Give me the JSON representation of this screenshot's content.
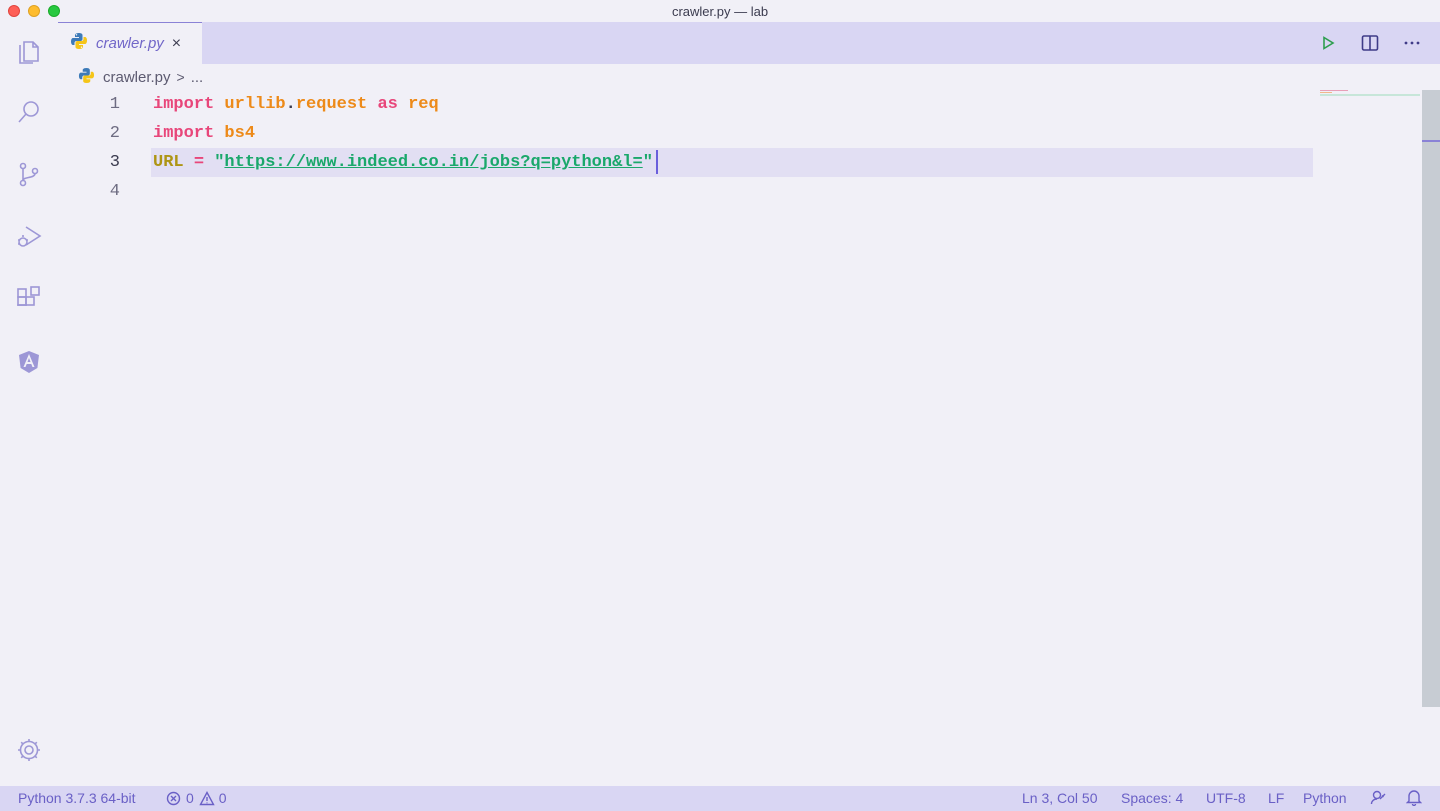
{
  "window": {
    "title": "crawler.py — lab"
  },
  "activity_bar": {
    "items": [
      "explorer-icon",
      "search-icon",
      "source-control-icon",
      "run-debug-icon",
      "extensions-icon",
      "angular-icon"
    ],
    "settings": "gear-icon"
  },
  "tabs": [
    {
      "label": "crawler.py",
      "icon": "python-icon",
      "close": "×"
    }
  ],
  "editor_actions": [
    "run-icon",
    "split-editor-icon",
    "more-actions-icon"
  ],
  "breadcrumb": {
    "file": "crawler.py",
    "separator": ">",
    "more": "..."
  },
  "editor": {
    "lines": [
      {
        "number": "1",
        "tokens": {
          "kw": "import",
          "mod1": "urllib",
          "dot": ".",
          "mod2": "request",
          "kw2": "as",
          "alias": "req"
        }
      },
      {
        "number": "2",
        "tokens": {
          "kw": "import",
          "mod": "bs4"
        }
      },
      {
        "number": "3",
        "tokens": {
          "var": "URL",
          "op": "=",
          "q1": "\"",
          "url": "https://www.indeed.co.in/jobs?q=python&l=",
          "q2": "\""
        }
      },
      {
        "number": "4"
      }
    ],
    "current_line": 3
  },
  "status_bar": {
    "interpreter": "Python 3.7.3 64-bit",
    "errors": "0",
    "warnings": "0",
    "cursor_position": "Ln 3, Col 50",
    "indentation": "Spaces: 4",
    "encoding": "UTF-8",
    "eol": "LF",
    "language": "Python"
  },
  "colors": {
    "accent": "#6a60c6",
    "keyword": "#e8467a",
    "module": "#ed8a19",
    "string": "#1aa86b",
    "variable": "#ae9514"
  }
}
